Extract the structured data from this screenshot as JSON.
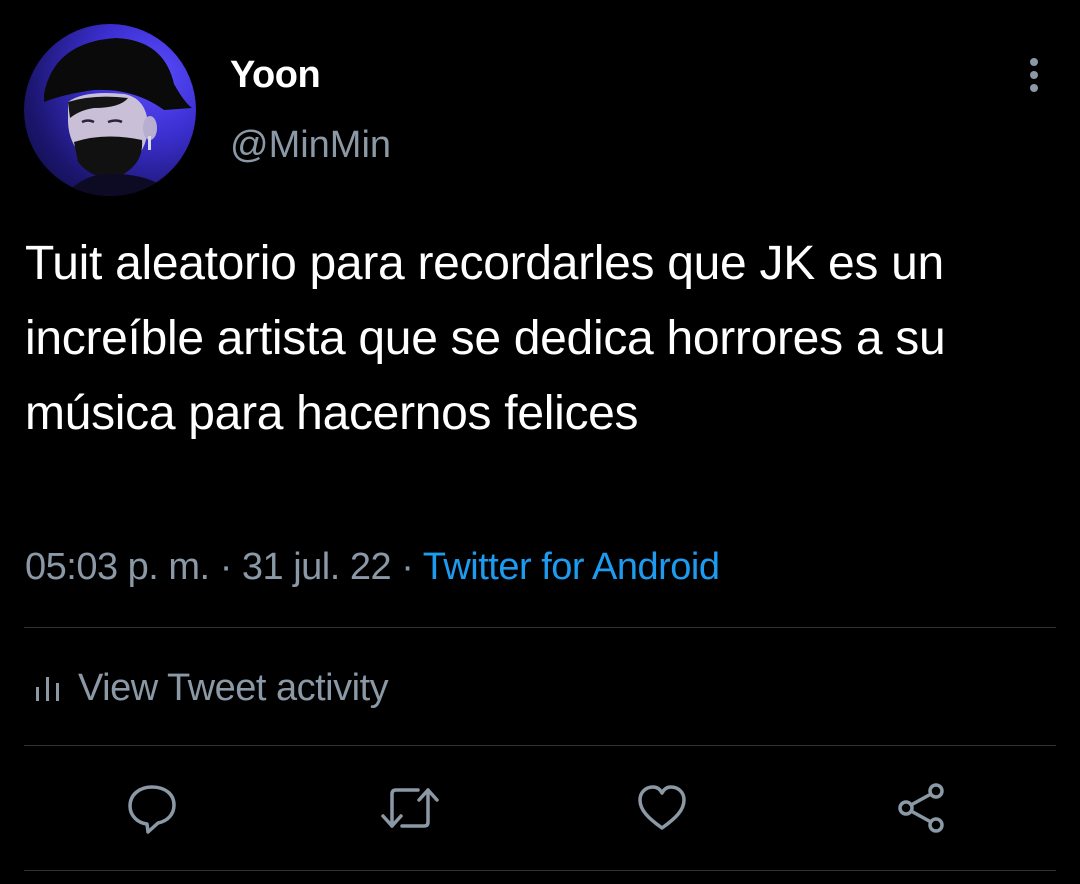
{
  "user": {
    "display_name": "Yoon",
    "handle": "@MinMin"
  },
  "tweet": {
    "text": "Tuit aleatorio para recordarles que JK es un increíble artista que se dedica horrores a su música para hacernos felices",
    "time": "05:03 p. m.",
    "separator": "·",
    "date": "31 jul. 22",
    "source": "Twitter for Android"
  },
  "activity": {
    "label": "View Tweet activity",
    "icon": "bar-chart-icon"
  },
  "actions": [
    {
      "name": "reply",
      "icon": "comment-icon"
    },
    {
      "name": "retweet",
      "icon": "retweet-icon"
    },
    {
      "name": "like",
      "icon": "heart-icon"
    },
    {
      "name": "share",
      "icon": "share-icon"
    }
  ],
  "colors": {
    "background": "#000000",
    "primary_text": "#ffffff",
    "secondary_text": "#8b98a5",
    "link": "#1d9bf0",
    "divider": "#2f3336"
  }
}
